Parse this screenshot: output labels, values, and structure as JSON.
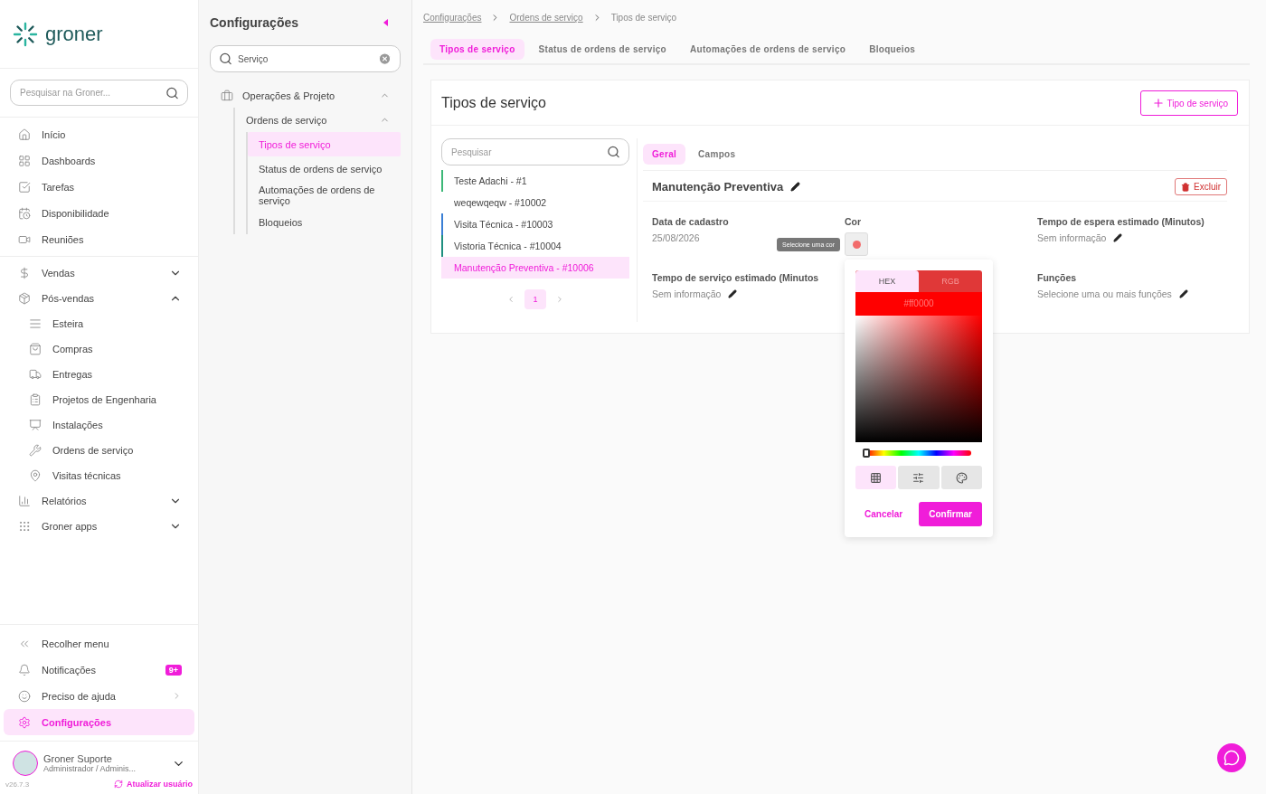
{
  "brand": {
    "name": "groner"
  },
  "sidebar": {
    "search": {
      "placeholder": "Pesquisar na Groner..."
    },
    "sections": [
      [
        {
          "label": "Início"
        },
        {
          "label": "Dashboards"
        },
        {
          "label": "Tarefas"
        },
        {
          "label": "Disponibilidade"
        },
        {
          "label": "Reuniões"
        }
      ],
      [
        {
          "label": "Vendas",
          "expanded": false
        },
        {
          "label": "Pós-vendas",
          "expanded": true,
          "children": [
            {
              "label": "Esteira"
            },
            {
              "label": "Compras"
            },
            {
              "label": "Entregas"
            },
            {
              "label": "Projetos de Engenharia"
            },
            {
              "label": "Instalações"
            },
            {
              "label": "Ordens de serviço"
            },
            {
              "label": "Visitas técnicas"
            }
          ]
        },
        {
          "label": "Relatórios",
          "expanded": false
        },
        {
          "label": "Groner apps",
          "expanded": false
        }
      ]
    ],
    "bottom": [
      {
        "label": "Recolher menu",
        "selected": false
      },
      {
        "label": "Notificações",
        "badge": "9+",
        "selected": false
      },
      {
        "label": "Preciso de ajuda",
        "selected": false,
        "arrow": true
      },
      {
        "label": "Configurações",
        "selected": true
      }
    ],
    "user": {
      "name": "Groner Suporte",
      "role": "Administrador / Adminis..."
    },
    "version": "v26.7.3",
    "refresh_link": "Atualizar usuário"
  },
  "settings_panel": {
    "title": "Configurações",
    "search": {
      "value": "Serviço"
    },
    "tree": [
      {
        "label": "Operações & Projeto",
        "expanded": true,
        "children": [
          {
            "label": "Ordens de serviço",
            "expanded": true,
            "children": [
              {
                "label": "Tipos de serviço",
                "selected": true
              },
              {
                "label": "Status de ordens de serviço",
                "selected": false
              },
              {
                "label": "Automações de ordens de serviço",
                "selected": false
              },
              {
                "label": "Bloqueios",
                "selected": false
              }
            ]
          }
        ]
      }
    ]
  },
  "breadcrumb": [
    {
      "label": "Configurações",
      "link": true
    },
    {
      "label": "Ordens de serviço",
      "link": true
    },
    {
      "label": "Tipos de serviço",
      "link": false
    }
  ],
  "tabs": [
    {
      "label": "Tipos de serviço",
      "selected": true
    },
    {
      "label": "Status de ordens de serviço",
      "selected": false
    },
    {
      "label": "Automações de ordens de serviço",
      "selected": false
    },
    {
      "label": "Bloqueios",
      "selected": false
    }
  ],
  "card": {
    "title": "Tipos de serviço",
    "add_button": "Tipo de serviço",
    "list": {
      "search": {
        "placeholder": "Pesquisar"
      },
      "items": [
        {
          "label": "Teste Adachi - #1",
          "selected": false,
          "color": "#3cb878"
        },
        {
          "label": "weqewqeqw - #10002",
          "selected": false
        },
        {
          "label": "Visita Técnica - #10003",
          "selected": false,
          "color": "#3a7fd5"
        },
        {
          "label": "Vistoria Técnica - #10004",
          "selected": false,
          "color": "#1f8f80"
        },
        {
          "label": "Manutenção Preventiva - #10006",
          "selected": true
        }
      ],
      "pages": [
        {
          "label": "1",
          "selected": true
        }
      ]
    },
    "detail": {
      "tabs": [
        {
          "label": "Geral",
          "selected": true
        },
        {
          "label": "Campos",
          "selected": false
        }
      ],
      "name": "Manutenção Preventiva",
      "delete_button": "Excluir",
      "fields": [
        {
          "kind": "text",
          "label": "Data de cadastro",
          "value": "25/08/2026",
          "editable": false
        },
        {
          "kind": "color",
          "label": "Cor",
          "color": "#f26b6b"
        },
        {
          "kind": "text",
          "label": "Tempo de espera estimado (Minutos)",
          "value": "Sem informação",
          "editable": true
        },
        {
          "kind": "text",
          "label": "Tempo de serviço estimado (Minutos",
          "value": "Sem informação",
          "editable": true
        },
        {
          "kind": "empty"
        },
        {
          "kind": "text",
          "label": "Funções",
          "value": "Selecione uma ou mais funções",
          "editable": true
        }
      ]
    }
  },
  "color_picker": {
    "tooltip": "Selecione uma cor",
    "tabs": [
      {
        "label": "HEX",
        "selected": true
      },
      {
        "label": "RGB",
        "selected": false
      }
    ],
    "value": "#ff0000",
    "hue": {
      "level": 0
    },
    "modes": [
      {
        "selected": true
      },
      {
        "selected": false
      },
      {
        "selected": false
      }
    ],
    "cancel": "Cancelar",
    "confirm": "Confirmar"
  }
}
